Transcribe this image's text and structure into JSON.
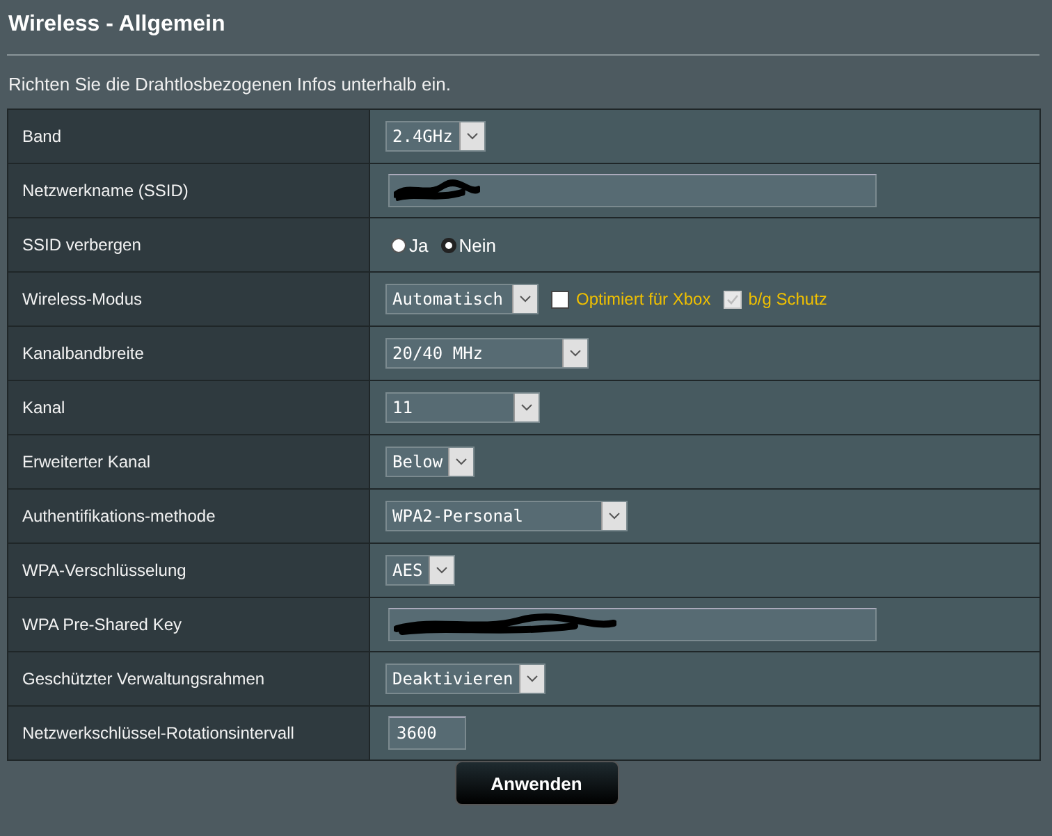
{
  "title": "Wireless - Allgemein",
  "intro": "Richten Sie die Drahtlosbezogenen Infos unterhalb ein.",
  "rows": [
    {
      "label": "Band",
      "kind": "select",
      "value": "2.4GHz"
    },
    {
      "label": "Netzwerkname (SSID)",
      "kind": "text",
      "redacted": true
    },
    {
      "label": "SSID verbergen",
      "kind": "radio",
      "options": [
        {
          "label": "Ja",
          "selected": false
        },
        {
          "label": "Nein",
          "selected": true
        }
      ]
    },
    {
      "label": "Wireless-Modus",
      "kind": "select",
      "value": "Automatisch",
      "checkboxes": [
        {
          "label": "Optimiert für Xbox",
          "checked": false,
          "disabled": false
        },
        {
          "label": "b/g Schutz",
          "checked": true,
          "disabled": true
        }
      ]
    },
    {
      "label": "Kanalbandbreite",
      "kind": "select",
      "value": "20/40 MHz"
    },
    {
      "label": "Kanal",
      "kind": "select",
      "value": "11"
    },
    {
      "label": "Erweiterter Kanal",
      "kind": "select",
      "value": "Below"
    },
    {
      "label": "Authentifikations-methode",
      "kind": "select",
      "value": "WPA2-Personal"
    },
    {
      "label": "WPA-Verschlüsselung",
      "kind": "select",
      "value": "AES"
    },
    {
      "label": "WPA Pre-Shared Key",
      "kind": "text",
      "redacted": true
    },
    {
      "label": "Geschützter Verwaltungsrahmen",
      "kind": "select",
      "value": "Deaktivieren"
    },
    {
      "label": "Netzwerkschlüssel-Rotationsintervall",
      "kind": "number",
      "value": "3600"
    }
  ],
  "apply_button": "Anwenden"
}
